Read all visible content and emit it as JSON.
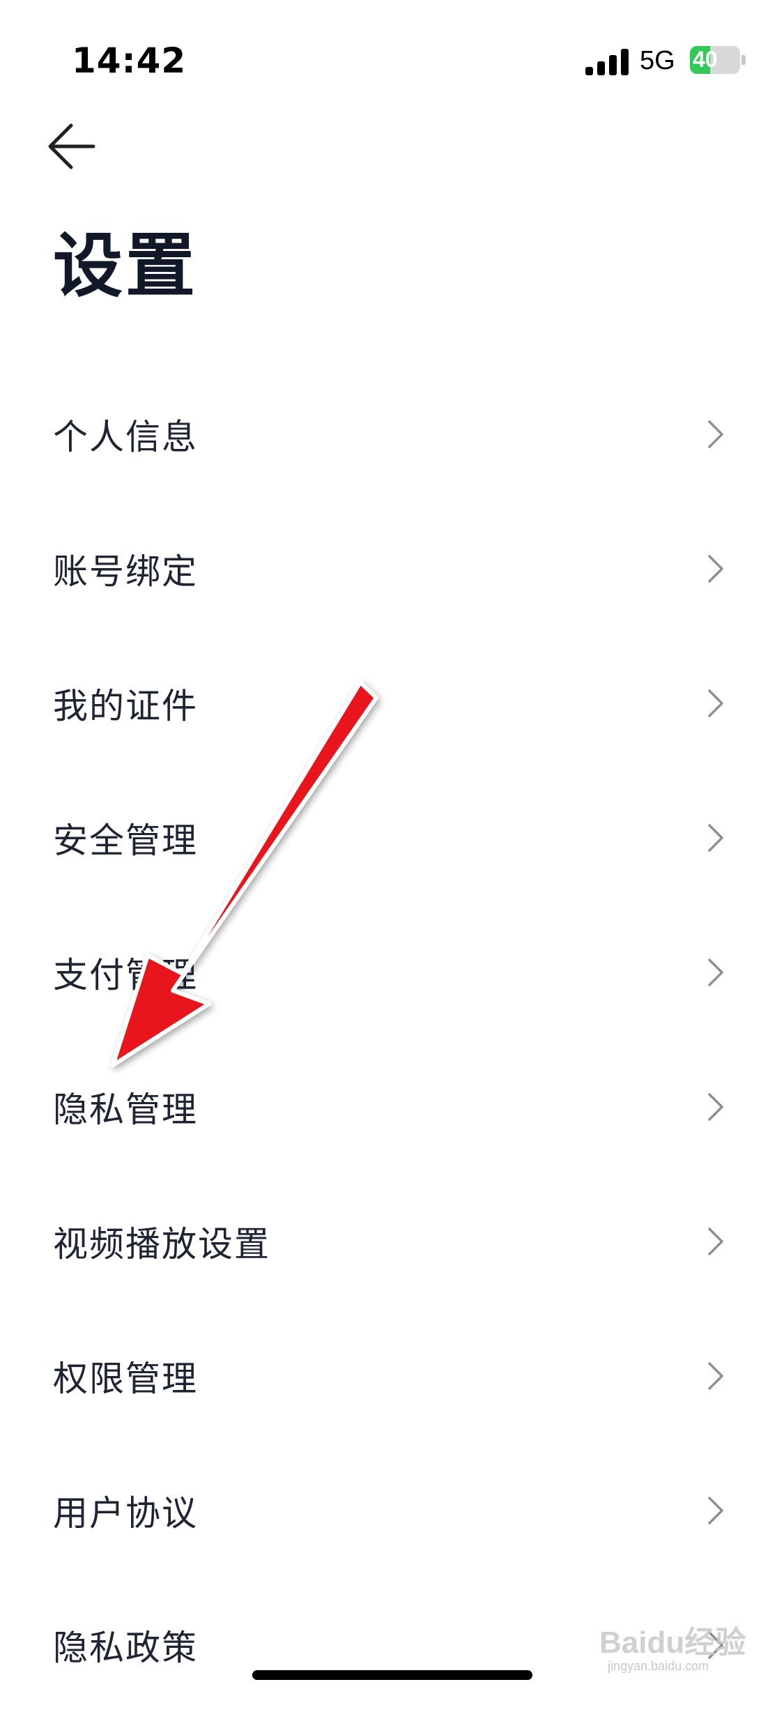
{
  "status_bar": {
    "time": "14:42",
    "network": "5G",
    "battery": "40",
    "battery_level": 0.4
  },
  "header": {
    "back_icon": "arrow-left-icon",
    "title": "设置"
  },
  "menu": {
    "items": [
      {
        "label": "个人信息"
      },
      {
        "label": "账号绑定"
      },
      {
        "label": "我的证件"
      },
      {
        "label": "安全管理"
      },
      {
        "label": "支付管理"
      },
      {
        "label": "隐私管理"
      },
      {
        "label": "视频播放设置"
      },
      {
        "label": "权限管理"
      },
      {
        "label": "用户协议"
      },
      {
        "label": "隐私政策"
      }
    ],
    "chevron_icon": "chevron-right-icon"
  },
  "annotation": {
    "arrow_color": "#e8141b",
    "target_item": "隐私管理"
  },
  "watermark": {
    "text": "Baidu经验",
    "sub": "jingyan.baidu.com"
  }
}
